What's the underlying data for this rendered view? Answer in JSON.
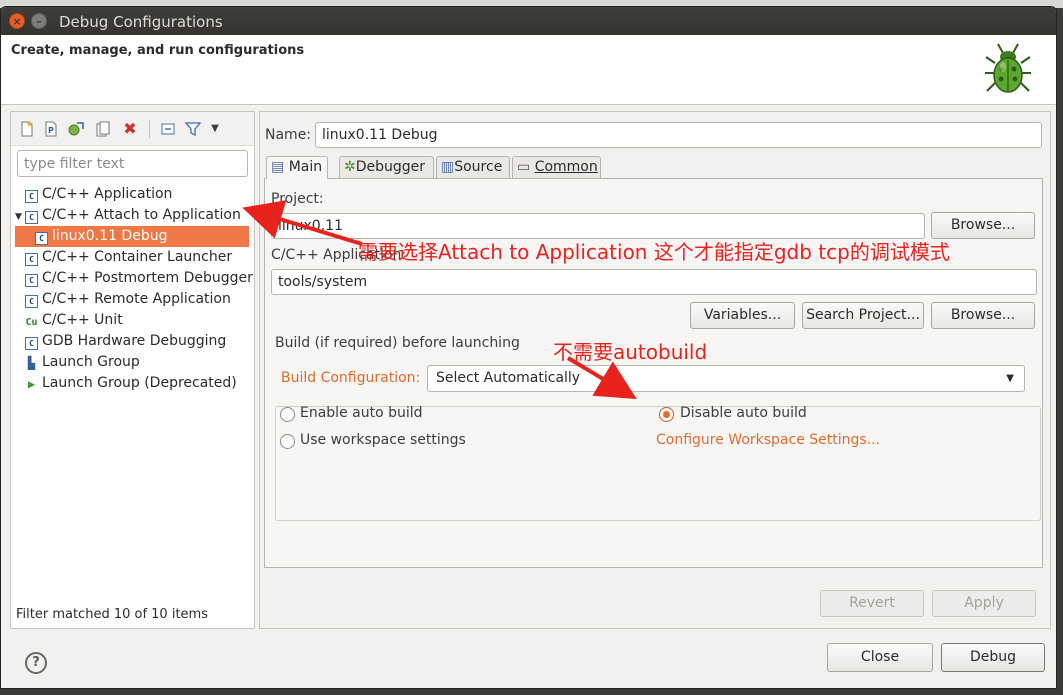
{
  "window": {
    "title": "Debug Configurations",
    "header": "Create, manage, and run configurations"
  },
  "sidebar": {
    "filter_placeholder": "type filter text",
    "items": [
      {
        "label": "C/C++ Application",
        "icon": "c-config-icon"
      },
      {
        "label": "C/C++ Attach to Application",
        "icon": "c-config-icon",
        "expanded": true
      },
      {
        "label": "linux0.11 Debug",
        "icon": "c-config-icon",
        "selected": true
      },
      {
        "label": "C/C++ Container Launcher",
        "icon": "c-config-icon"
      },
      {
        "label": "C/C++ Postmortem Debugger",
        "icon": "c-config-icon"
      },
      {
        "label": "C/C++ Remote Application",
        "icon": "c-config-icon"
      },
      {
        "label": "C/C++ Unit",
        "icon": "cunit-icon"
      },
      {
        "label": "GDB Hardware Debugging",
        "icon": "c-config-icon"
      },
      {
        "label": "Launch Group",
        "icon": "launch-group-icon"
      },
      {
        "label": "Launch Group (Deprecated)",
        "icon": "run-icon"
      }
    ],
    "status": "Filter matched 10 of 10 items"
  },
  "config": {
    "name_label": "Name:",
    "name_value": "linux0.11 Debug",
    "tabs": [
      {
        "label": "Main"
      },
      {
        "label": "Debugger"
      },
      {
        "label": "Source"
      },
      {
        "label": "Common"
      }
    ],
    "project_label": "Project:",
    "project_value": "linux0.11",
    "browse_label": "Browse...",
    "app_label": "C/C++ Application:",
    "app_value": "tools/system",
    "variables_label": "Variables...",
    "search_project_label": "Search Project...",
    "build_group_label": "Build (if required) before launching",
    "build_config_label": "Build Configuration:",
    "build_config_value": "Select Automatically",
    "enable_auto_build": "Enable auto build",
    "disable_auto_build": "Disable auto build",
    "use_workspace_settings": "Use workspace settings",
    "configure_workspace_link": "Configure Workspace Settings...",
    "revert_label": "Revert",
    "apply_label": "Apply"
  },
  "footer": {
    "close_label": "Close",
    "debug_label": "Debug"
  },
  "annotations": {
    "attach_note": "需要选择Attach to Application 这个才能指定gdb tcp的调试模式",
    "autobuild_note": "不需要autobuild"
  },
  "colors": {
    "accent": "#f07746",
    "annotation": "#e8231e",
    "link": "#e06b2f"
  }
}
